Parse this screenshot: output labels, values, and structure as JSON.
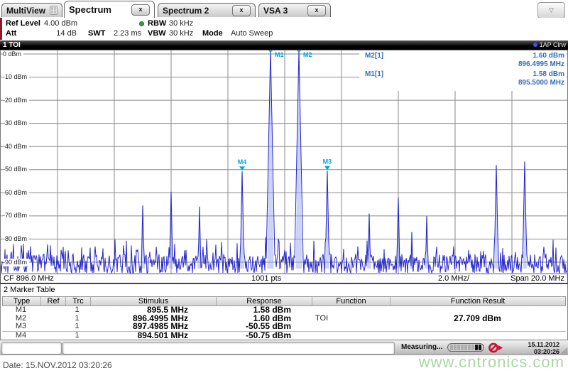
{
  "icons": {
    "close": "x",
    "overflow": "▽"
  },
  "tabs": [
    {
      "label": "MultiView"
    },
    {
      "label": "Spectrum"
    },
    {
      "label": "Spectrum 2"
    },
    {
      "label": "VSA 3"
    }
  ],
  "channel_bar": {
    "ref_level_label": "Ref Level",
    "ref_level": "4.00 dBm",
    "att_label": "Att",
    "att": "14 dB",
    "swt_label": "SWT",
    "swt": "2.23 ms",
    "rbw_label": "RBW",
    "rbw": "30 kHz",
    "vbw_label": "VBW",
    "vbw": "30 kHz",
    "mode_label": "Mode",
    "mode": "Auto Sweep"
  },
  "window1": {
    "title": "1 TOI",
    "trace_label": "1AP Clrw",
    "markers_readout": [
      {
        "name": "M2[1]",
        "level": "1.60 dBm",
        "freq": "896.4995 MHz"
      },
      {
        "name": "M1[1]",
        "level": "1.58 dBm",
        "freq": "895.5000 MHz"
      }
    ],
    "footer": {
      "cf": "CF 896.0 MHz",
      "pts": "1001 pts",
      "per_div": "2.0 MHz/",
      "span": "Span 20.0 MHz"
    }
  },
  "chart_data": {
    "type": "line",
    "title": "1 TOI spectrum trace",
    "x_range_mhz": [
      886.0,
      906.0
    ],
    "mhz_per_div": 2.0,
    "points": 1001,
    "ylim_dbm": [
      -90,
      0
    ],
    "ref_level_dbm": 4.0,
    "y_tick_labels": [
      "0 dBm",
      "-10 dBm",
      "-20 dBm",
      "-30 dBm",
      "-40 dBm",
      "-50 dBm",
      "-60 dBm",
      "-70 dBm",
      "-80 dBm",
      "-90 dBm"
    ],
    "noise_floor_dbm": -90,
    "trace_color": "#2626cd",
    "marker_color": "#00a6e8",
    "peaks": [
      {
        "freq_mhz": 891.0,
        "level_dbm": -65.5
      },
      {
        "freq_mhz": 892.0,
        "level_dbm": -59.5
      },
      {
        "freq_mhz": 893.0,
        "level_dbm": -66.0
      },
      {
        "freq_mhz": 894.501,
        "level_dbm": -50.75,
        "marker": "M4"
      },
      {
        "freq_mhz": 895.5,
        "level_dbm": 1.58,
        "marker": "M1"
      },
      {
        "freq_mhz": 896.4995,
        "level_dbm": 1.6,
        "marker": "M2"
      },
      {
        "freq_mhz": 897.4985,
        "level_dbm": -50.55,
        "marker": "M3"
      },
      {
        "freq_mhz": 898.975,
        "level_dbm": -69.0
      },
      {
        "freq_mhz": 900.0,
        "level_dbm": -62.0
      },
      {
        "freq_mhz": 900.475,
        "level_dbm": -77.0
      },
      {
        "freq_mhz": 901.0,
        "level_dbm": -70.0
      },
      {
        "freq_mhz": 903.45,
        "level_dbm": -48.0
      },
      {
        "freq_mhz": 904.45,
        "level_dbm": -46.5
      }
    ]
  },
  "marker_table": {
    "title": "2 Marker Table",
    "columns": [
      "Type",
      "Ref",
      "Trc",
      "Stimulus",
      "Response",
      "Function",
      "Function Result"
    ],
    "rows": [
      {
        "type": "M1",
        "ref": "",
        "trc": "1",
        "stimulus": "895.5 MHz",
        "response": "1.58 dBm",
        "function": "",
        "result": ""
      },
      {
        "type": "M2",
        "ref": "",
        "trc": "1",
        "stimulus": "896.4995 MHz",
        "response": "1.60 dBm",
        "function": "TOI",
        "result": "27.709 dBm"
      },
      {
        "type": "M3",
        "ref": "",
        "trc": "1",
        "stimulus": "897.4985 MHz",
        "response": "-50.55 dBm",
        "function": "",
        "result": ""
      },
      {
        "type": "M4",
        "ref": "",
        "trc": "1",
        "stimulus": "894.501 MHz",
        "response": "-50.75 dBm",
        "function": "",
        "result": ""
      }
    ]
  },
  "status_bar": {
    "status": "Measuring...",
    "date": "15.11.2012",
    "time": "03:20:26"
  },
  "footer_area": {
    "date_text": "Date: 15.NOV.2012  03:20:26",
    "watermark": "www.cntronics.com"
  }
}
